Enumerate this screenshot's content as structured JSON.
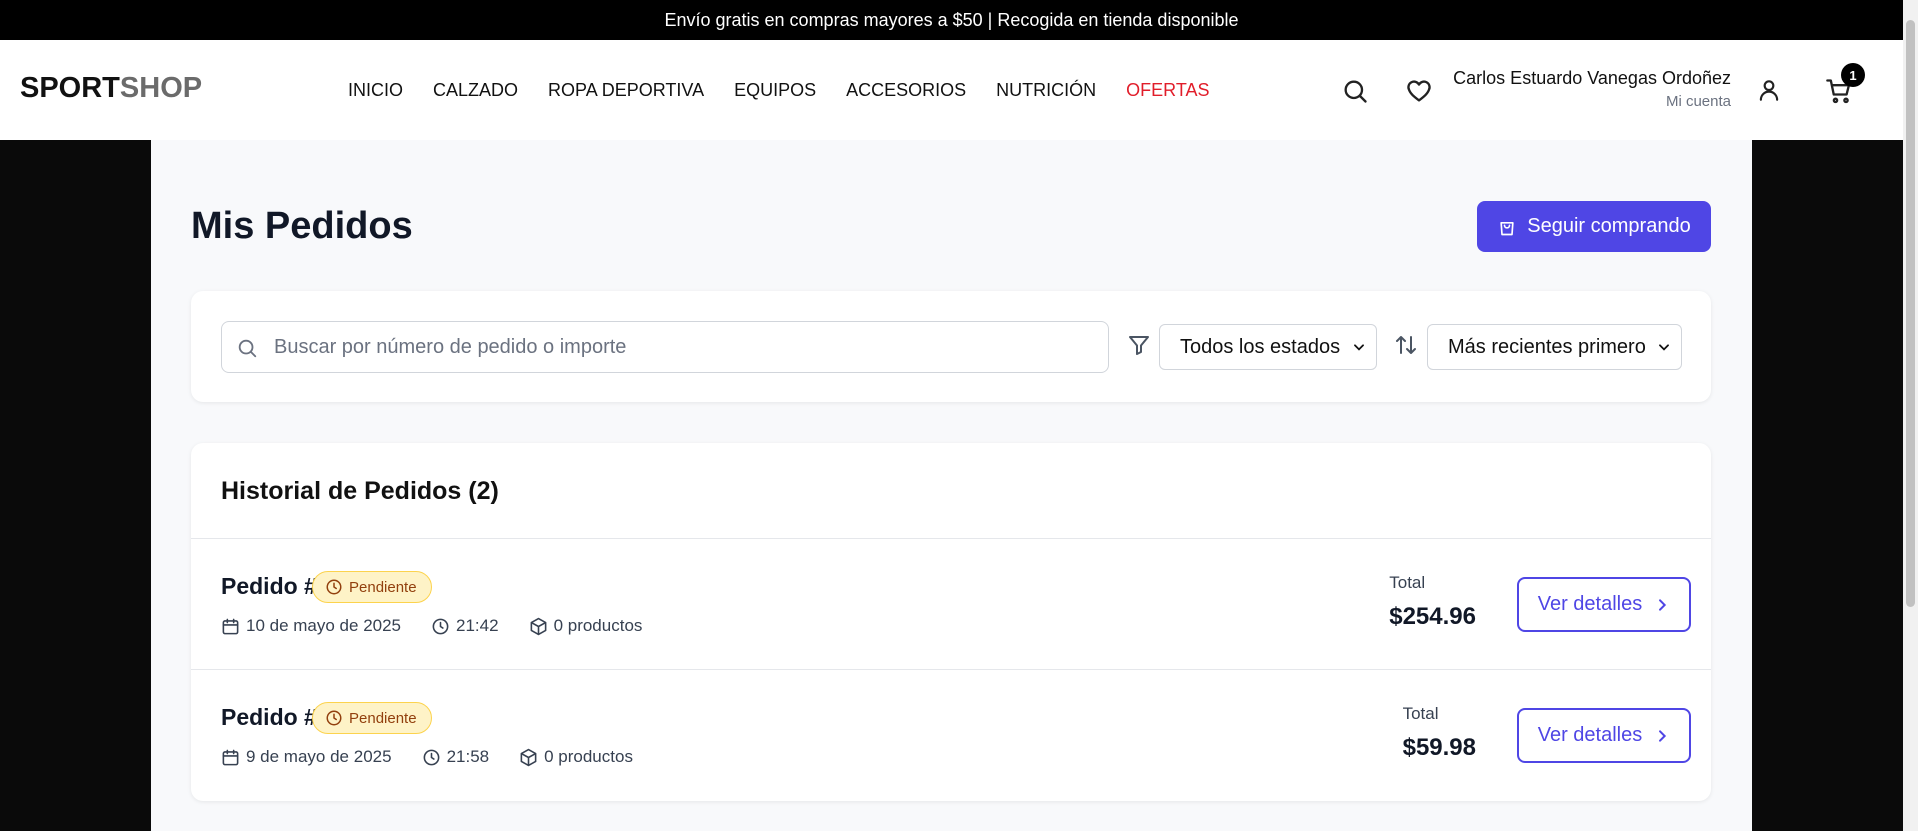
{
  "promo": {
    "text": "Envío gratis en compras mayores a $50 | Recogida en tienda disponible"
  },
  "header": {
    "logo_part1": "SPORT",
    "logo_part2": "SHOP",
    "nav": [
      {
        "label": "INICIO"
      },
      {
        "label": "CALZADO"
      },
      {
        "label": "ROPA DEPORTIVA"
      },
      {
        "label": "EQUIPOS"
      },
      {
        "label": "ACCESORIOS"
      },
      {
        "label": "NUTRICIÓN"
      },
      {
        "label": "OFERTAS"
      }
    ],
    "user_name": "Carlos Estuardo Vanegas Ordoñez",
    "account_label": "Mi cuenta",
    "cart_count": "1",
    "icons": [
      "search-icon",
      "heart-icon",
      "user-icon",
      "cart-icon"
    ]
  },
  "page": {
    "title": "Mis Pedidos",
    "continue_button": "Seguir comprando"
  },
  "filters": {
    "search_placeholder": "Buscar por número de pedido o importe",
    "status_selected": "Todos los estados",
    "sort_selected": "Más recientes primero"
  },
  "orders": {
    "title": "Historial de Pedidos (2)",
    "total_label": "Total",
    "details_button": "Ver detalles",
    "items": [
      {
        "id": "Pedido #4",
        "status": "Pendiente",
        "date": "10 de mayo de 2025",
        "time": "21:42",
        "products": "0 productos",
        "total": "$254.96"
      },
      {
        "id": "Pedido #3",
        "status": "Pendiente",
        "date": "9 de mayo de 2025",
        "time": "21:58",
        "products": "0 productos",
        "total": "$59.98"
      }
    ]
  },
  "colors": {
    "accent": "#4f46e5",
    "offer": "#e11d2a",
    "pending_bg": "#fef3c7",
    "pending_text": "#92400e"
  }
}
